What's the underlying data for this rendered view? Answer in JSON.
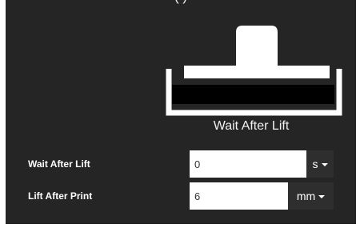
{
  "panel": {
    "cut_heading": "(     )"
  },
  "illustration": {
    "caption": "Wait After Lift"
  },
  "fields": {
    "wait_after_lift": {
      "label": "Wait After Lift",
      "value": "0",
      "unit": "s"
    },
    "lift_after_print": {
      "label": "Lift After Print",
      "value": "6",
      "unit": "mm"
    }
  },
  "colors": {
    "panel_background": "#252525",
    "text": "#f2f2f2",
    "input_background": "#ffffff",
    "unit_button": "#2e2e2e",
    "plate_fill": "#000000"
  },
  "icons": {
    "unit_dropdown": "caret-down-icon"
  }
}
